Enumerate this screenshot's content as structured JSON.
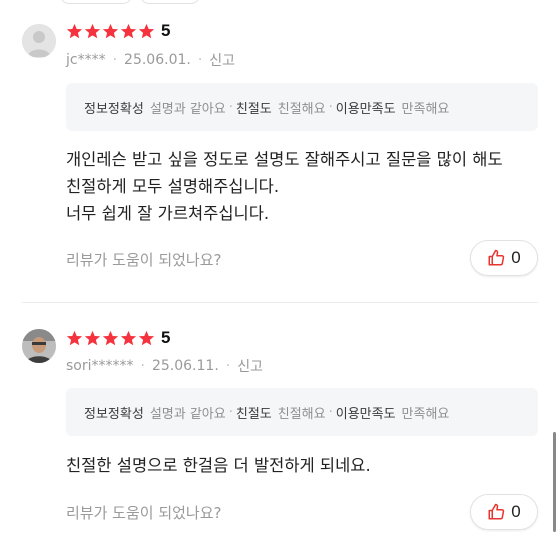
{
  "colors": {
    "star": "#f5333f",
    "like_icon": "#e8342e",
    "tag_bg": "#f5f6f8"
  },
  "reviews": [
    {
      "rating": "5",
      "user": "jc****",
      "date": "25.06.01.",
      "report_label": "신고",
      "tags": [
        {
          "label": "정보정확성",
          "value": "설명과 같아요"
        },
        {
          "label": "친절도",
          "value": "친절해요"
        },
        {
          "label": "이용만족도",
          "value": "만족해요"
        }
      ],
      "body_lines": [
        "개인레슨 받고 싶을 정도로 설명도 잘해주시고 질문을 많이 해도",
        "친절하게 모두 설명해주십니다.",
        "너무 쉽게 잘 가르쳐주십니다."
      ],
      "helpful_prompt": "리뷰가 도움이 되었나요?",
      "like_count": "0"
    },
    {
      "rating": "5",
      "user": "sori******",
      "date": "25.06.11.",
      "report_label": "신고",
      "tags": [
        {
          "label": "정보정확성",
          "value": "설명과 같아요"
        },
        {
          "label": "친절도",
          "value": "친절해요"
        },
        {
          "label": "이용만족도",
          "value": "만족해요"
        }
      ],
      "body_lines": [
        "친절한 설명으로 한걸음 더 발전하게 되네요."
      ],
      "helpful_prompt": "리뷰가 도움이 되었나요?",
      "like_count": "0"
    }
  ]
}
